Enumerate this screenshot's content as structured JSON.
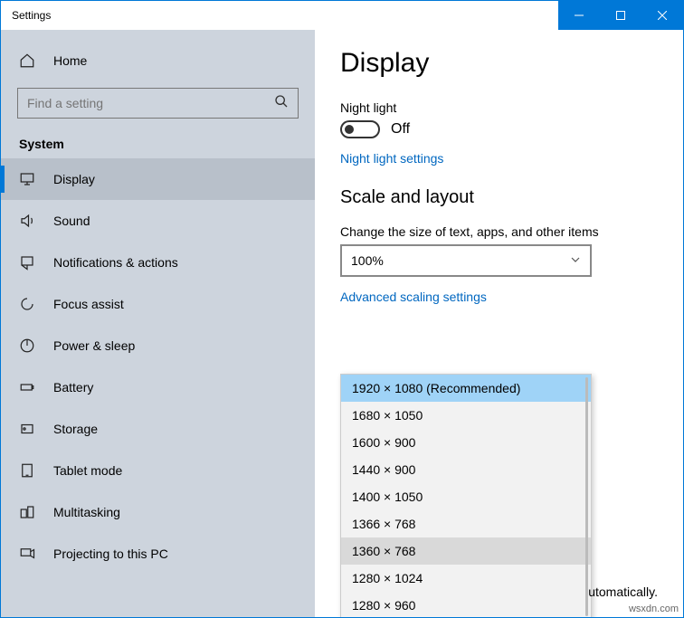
{
  "window_title": "Settings",
  "home_label": "Home",
  "search_placeholder": "Find a setting",
  "section_title": "System",
  "nav": [
    {
      "label": "Display",
      "icon": "monitor",
      "selected": true
    },
    {
      "label": "Sound",
      "icon": "sound"
    },
    {
      "label": "Notifications & actions",
      "icon": "notifications"
    },
    {
      "label": "Focus assist",
      "icon": "focus"
    },
    {
      "label": "Power & sleep",
      "icon": "power"
    },
    {
      "label": "Battery",
      "icon": "battery"
    },
    {
      "label": "Storage",
      "icon": "storage"
    },
    {
      "label": "Tablet mode",
      "icon": "tablet"
    },
    {
      "label": "Multitasking",
      "icon": "multitask"
    },
    {
      "label": "Projecting to this PC",
      "icon": "project"
    }
  ],
  "main": {
    "title": "Display",
    "night_light_label": "Night light",
    "night_light_state": "Off",
    "night_light_link": "Night light settings",
    "scale_heading": "Scale and layout",
    "scale_label": "Change the size of text, apps, and other items",
    "scale_value": "100%",
    "advanced_link": "Advanced scaling settings",
    "resolutions": [
      "1920 × 1080 (Recommended)",
      "1680 × 1050",
      "1600 × 900",
      "1440 × 900",
      "1400 × 1050",
      "1366 × 768",
      "1360 × 768",
      "1280 × 1024",
      "1280 × 960"
    ],
    "resolution_selected_index": 0,
    "resolution_hover_index": 6,
    "tail_text": "utomatically."
  },
  "watermark": "wsxdn.com"
}
